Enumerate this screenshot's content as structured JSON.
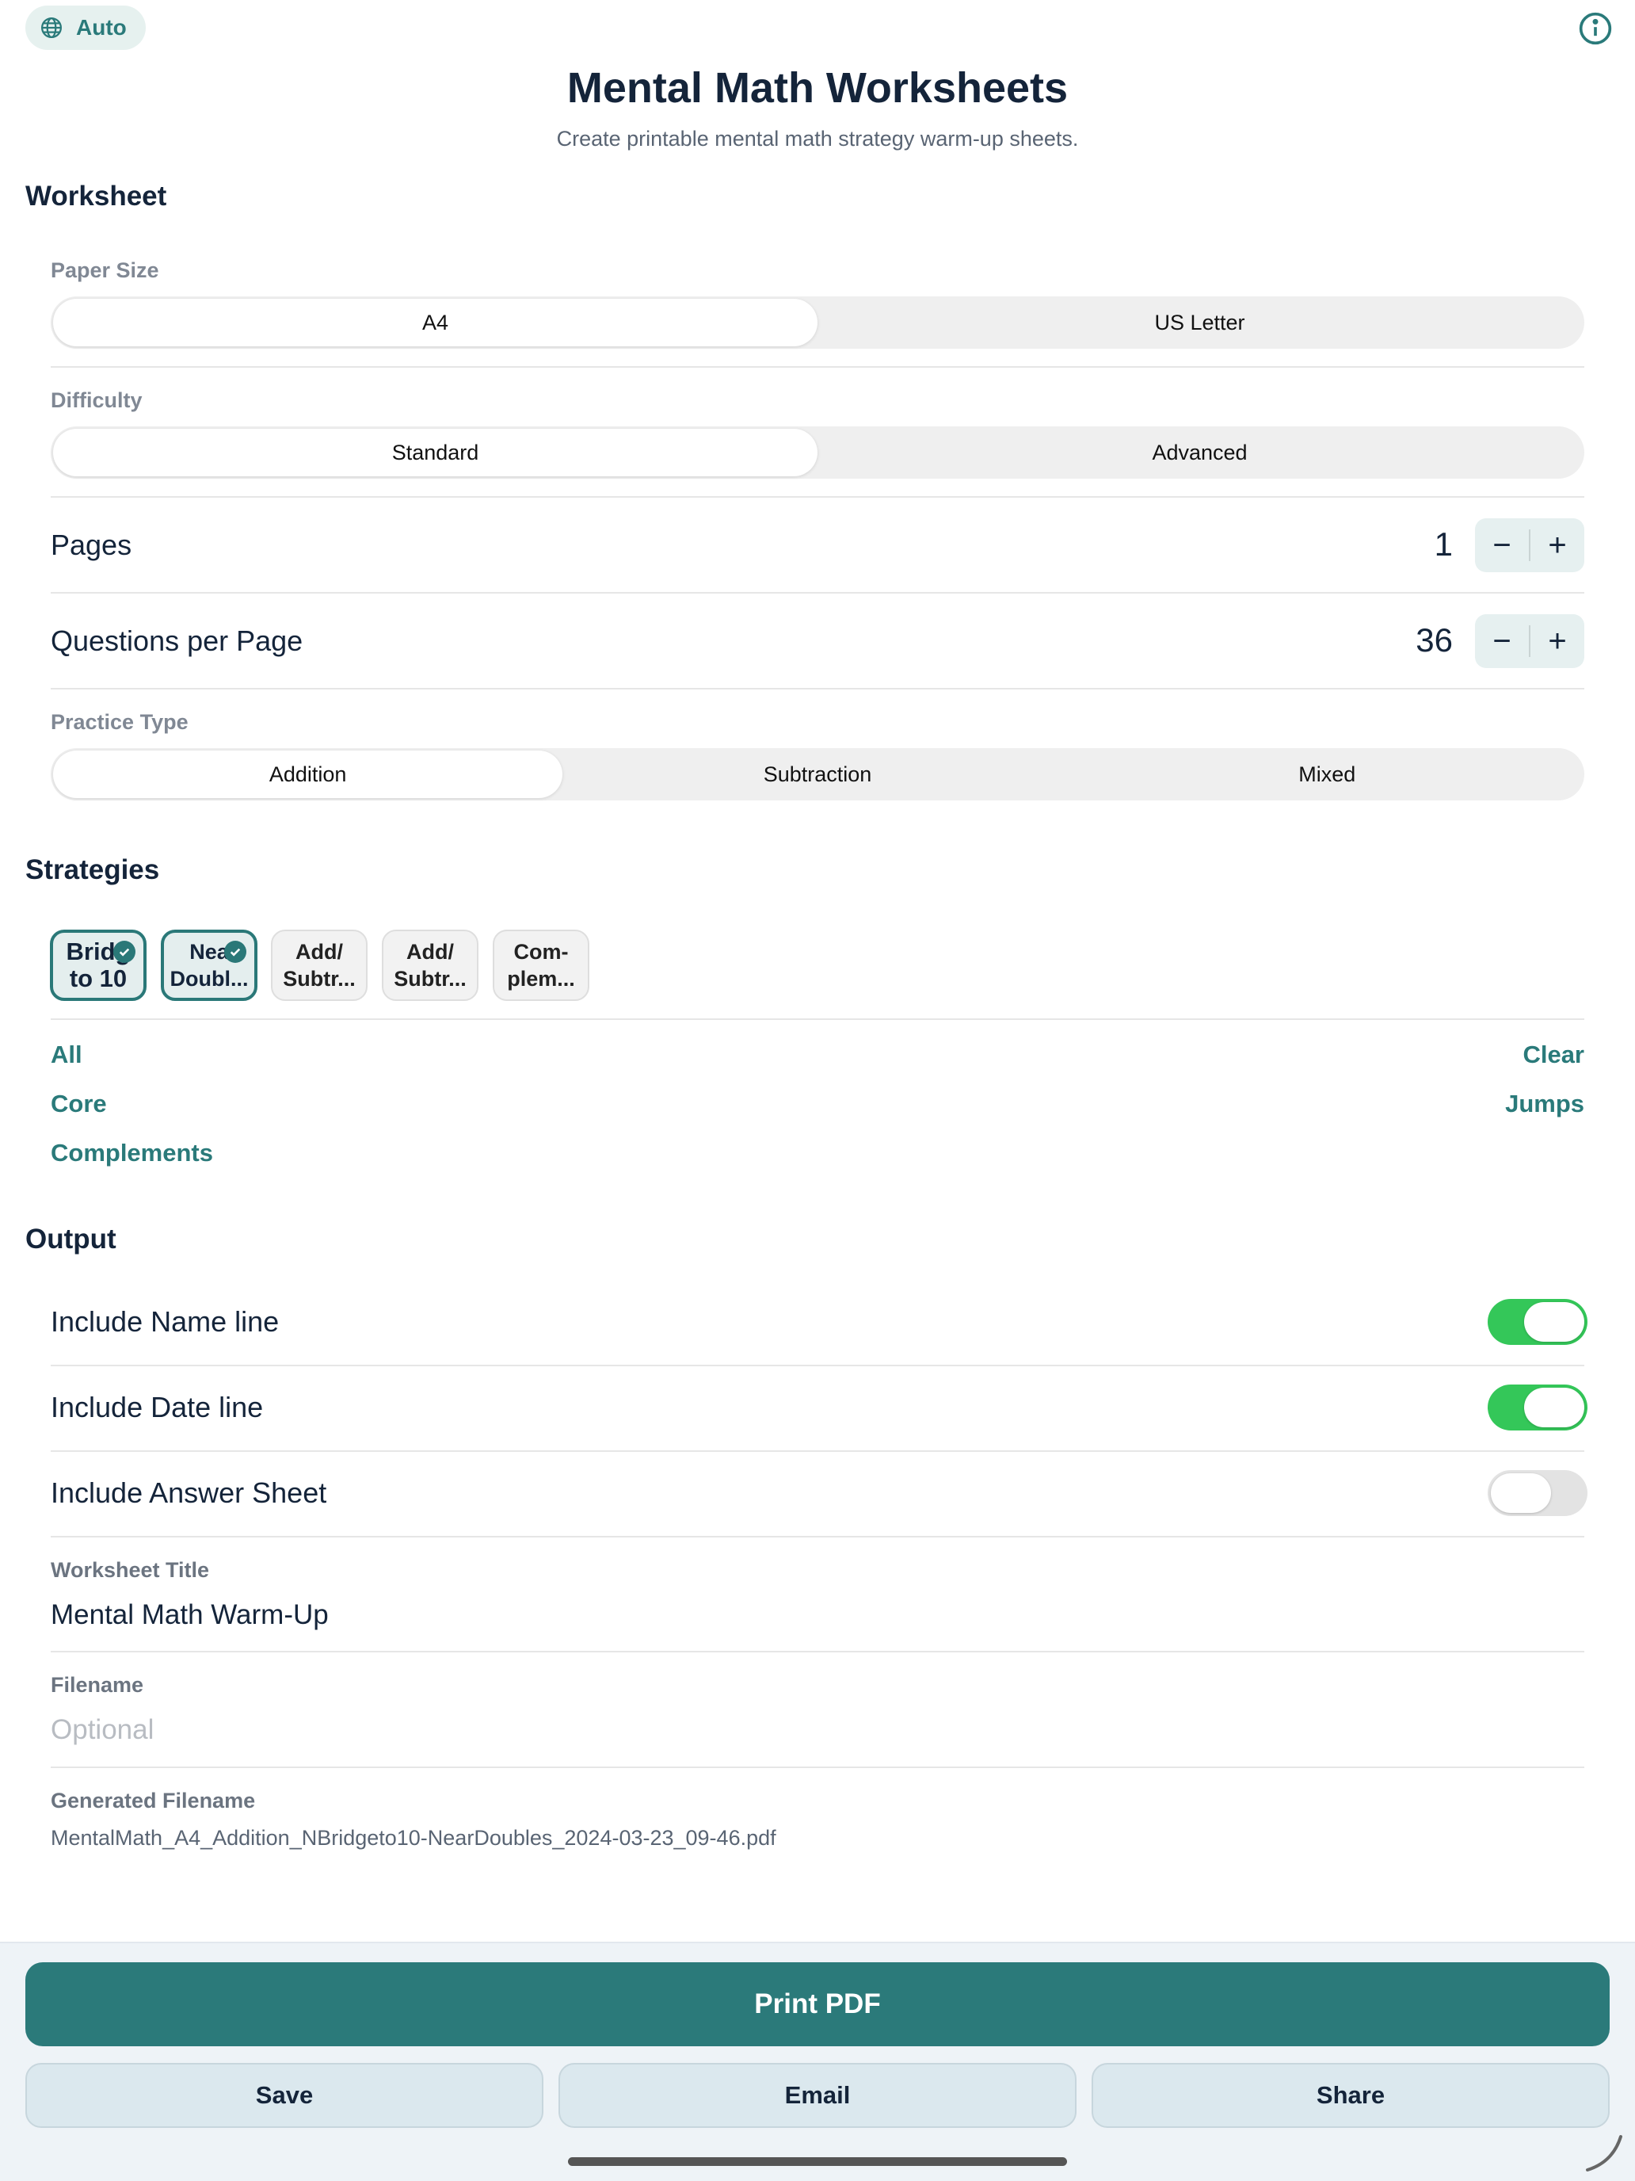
{
  "header": {
    "language": "Auto",
    "title": "Mental Math Worksheets",
    "subtitle": "Create printable mental math strategy warm-up sheets."
  },
  "worksheet": {
    "section_title": "Worksheet",
    "paper_size": {
      "label": "Paper Size",
      "options": [
        "A4",
        "US Letter"
      ],
      "selected": "A4"
    },
    "difficulty": {
      "label": "Difficulty",
      "options": [
        "Standard",
        "Advanced"
      ],
      "selected": "Standard"
    },
    "pages": {
      "label": "Pages",
      "value": "1"
    },
    "questions": {
      "label": "Questions per Page",
      "value": "36"
    },
    "practice_type": {
      "label": "Practice Type",
      "options": [
        "Addition",
        "Subtraction",
        "Mixed"
      ],
      "selected": "Addition"
    }
  },
  "strategies": {
    "section_title": "Strategies",
    "chips": [
      {
        "line1": "Bridg",
        "line2": "to 10",
        "selected": true
      },
      {
        "line1": "Nea",
        "line2": "Doubl...",
        "selected": true
      },
      {
        "line1": "Add/",
        "line2": "Subtr...",
        "selected": false
      },
      {
        "line1": "Add/",
        "line2": "Subtr...",
        "selected": false
      },
      {
        "line1": "Com-",
        "line2": "plem...",
        "selected": false
      }
    ],
    "links": {
      "all": "All",
      "clear": "Clear",
      "core": "Core",
      "jumps": "Jumps",
      "complements": "Complements"
    }
  },
  "output": {
    "section_title": "Output",
    "toggles": [
      {
        "label": "Include Name line",
        "on": true
      },
      {
        "label": "Include Date line",
        "on": true
      },
      {
        "label": "Include Answer Sheet",
        "on": false
      }
    ],
    "worksheet_title": {
      "label": "Worksheet Title",
      "value": "Mental Math Warm-Up"
    },
    "filename": {
      "label": "Filename",
      "placeholder": "Optional"
    },
    "generated": {
      "label": "Generated Filename",
      "value": "MentalMath_A4_Addition_NBridgeto10-NearDoubles_2024-03-23_09-46.pdf"
    }
  },
  "actions": {
    "print": "Print PDF",
    "save": "Save",
    "email": "Email",
    "share": "Share"
  },
  "colors": {
    "accent": "#2b7a7a",
    "toggle_on": "#34c759",
    "toggle_off": "#e3e3e3",
    "title": "#14243a"
  }
}
